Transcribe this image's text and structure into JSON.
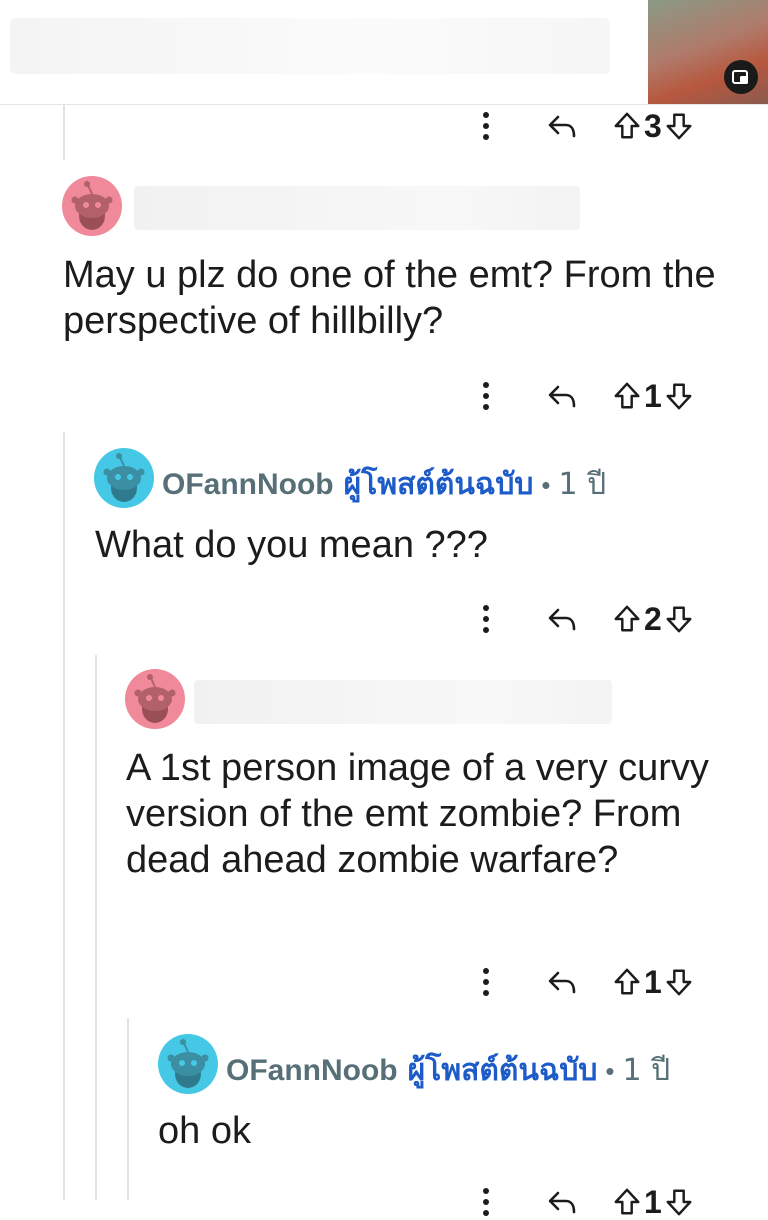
{
  "comments": [
    {
      "id": "c0",
      "votes": "3"
    },
    {
      "id": "c1",
      "username": "",
      "body": "May u plz do one of the emt? From the perspective of hillbilly?",
      "votes": "1"
    },
    {
      "id": "c2",
      "username": "OFannNoob",
      "op_badge": "ผู้โพสต์ต้นฉบับ",
      "separator": "•",
      "age": "1 ปี",
      "body": "What do you mean ???",
      "votes": "2"
    },
    {
      "id": "c3",
      "username": "",
      "body": "A 1st person image of a very curvy version of the emt zombie? From dead ahead zombie warfare?",
      "votes": "1"
    },
    {
      "id": "c4",
      "username": "OFannNoob",
      "op_badge": "ผู้โพสต์ต้นฉบับ",
      "separator": "•",
      "age": "1 ปี",
      "body": "oh ok",
      "votes": "1"
    }
  ],
  "icons": {
    "more": "more-options-icon",
    "reply": "reply-arrow-icon",
    "upvote": "upvote-arrow-icon",
    "downvote": "downvote-arrow-icon",
    "avatar": "reddit-snoo-avatar",
    "pip": "picture-in-picture-icon"
  },
  "colors": {
    "avatar_pink": "#f08a9a",
    "avatar_cyan": "#45c8e6",
    "username": "#576f76",
    "op_badge": "#1d5bc8",
    "thread_line": "#e2e2e2"
  }
}
